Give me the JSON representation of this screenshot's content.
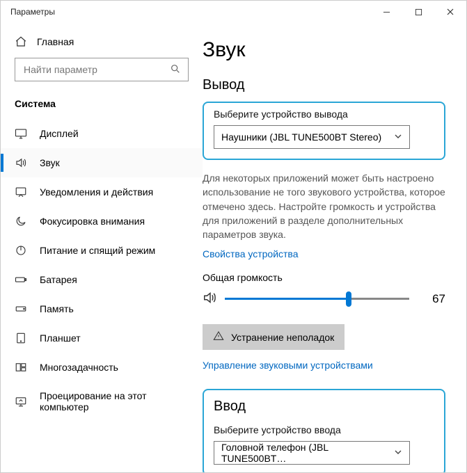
{
  "titlebar": {
    "title": "Параметры"
  },
  "home_label": "Главная",
  "search": {
    "placeholder": "Найти параметр"
  },
  "section_label": "Система",
  "nav": [
    {
      "label": "Дисплей"
    },
    {
      "label": "Звук"
    },
    {
      "label": "Уведомления и действия"
    },
    {
      "label": "Фокусировка внимания"
    },
    {
      "label": "Питание и спящий режим"
    },
    {
      "label": "Батарея"
    },
    {
      "label": "Память"
    },
    {
      "label": "Планшет"
    },
    {
      "label": "Многозадачность"
    },
    {
      "label": "Проецирование на этот компьютер"
    }
  ],
  "page_title": "Звук",
  "output": {
    "heading": "Вывод",
    "select_label": "Выберите устройство вывода",
    "device": "Наушники (JBL TUNE500BT Stereo)",
    "description": "Для некоторых приложений может быть настроено использование не того звукового устройства, которое отмечено здесь. Настройте громкость и устройства для приложений в разделе дополнительных параметров звука.",
    "properties_link": "Свойства устройства",
    "volume_label": "Общая громкость",
    "volume_value": "67",
    "troubleshoot": "Устранение неполадок",
    "manage_link": "Управление звуковыми устройствами"
  },
  "input": {
    "heading": "Ввод",
    "select_label": "Выберите устройство ввода",
    "device": "Головной телефон (JBL TUNE500BT…"
  }
}
